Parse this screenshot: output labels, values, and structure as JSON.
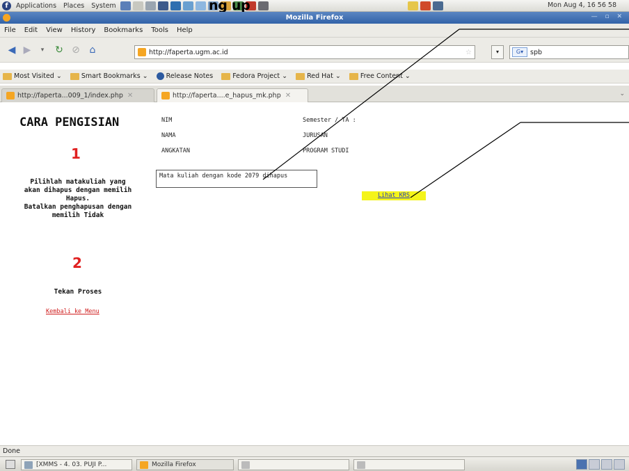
{
  "top_panel": {
    "menus": [
      "Applications",
      "Places",
      "System"
    ],
    "clock": "Mon Aug  4, 16 56 58"
  },
  "overlay_title": "ng up",
  "window": {
    "title": "Mozilla Firefox"
  },
  "menubar": {
    "items": [
      "File",
      "Edit",
      "View",
      "History",
      "Bookmarks",
      "Tools",
      "Help"
    ]
  },
  "navbar": {
    "url": "http://faperta.ugm.ac.id",
    "search_value": "spb",
    "search_engine": "G"
  },
  "bookmarks": {
    "items": [
      "Most Visited",
      "Smart Bookmarks",
      "Release Notes",
      "Fedora Project",
      "Red Hat",
      "Free Content"
    ]
  },
  "tabs": [
    {
      "label": "http://faperta...009_1/index.php"
    },
    {
      "label": "http://faperta....e_hapus_mk.php"
    }
  ],
  "page": {
    "heading": "CARA PENGISIAN",
    "step1_number": "1",
    "step1_text_line1": "Pilihlah matakuliah yang",
    "step1_text_line2": "akan dihapus dengan memilih",
    "step1_text_line3": "Hapus.",
    "step1_text_line4": "Batalkan penghapusan dengan",
    "step1_text_line5": "memilih Tidak",
    "step2_number": "2",
    "step2_text": "Tekan Proses",
    "back_link": "Kembali ke Menu",
    "labels": {
      "nim": "NIM",
      "nama": "NAMA",
      "angkatan": "ANGKATAN",
      "semester": "Semester / TA :",
      "jurusan": "JURUSAN",
      "program": "PROGRAM STUDI"
    },
    "message": "Mata kuliah dengan kode 2079 dihapus",
    "krs_link": "Lihat KRS"
  },
  "status": "Done",
  "taskbar": {
    "tasks": [
      "[XMMS - 4. 03. PUJI P...",
      "Mozilla Firefox"
    ]
  }
}
